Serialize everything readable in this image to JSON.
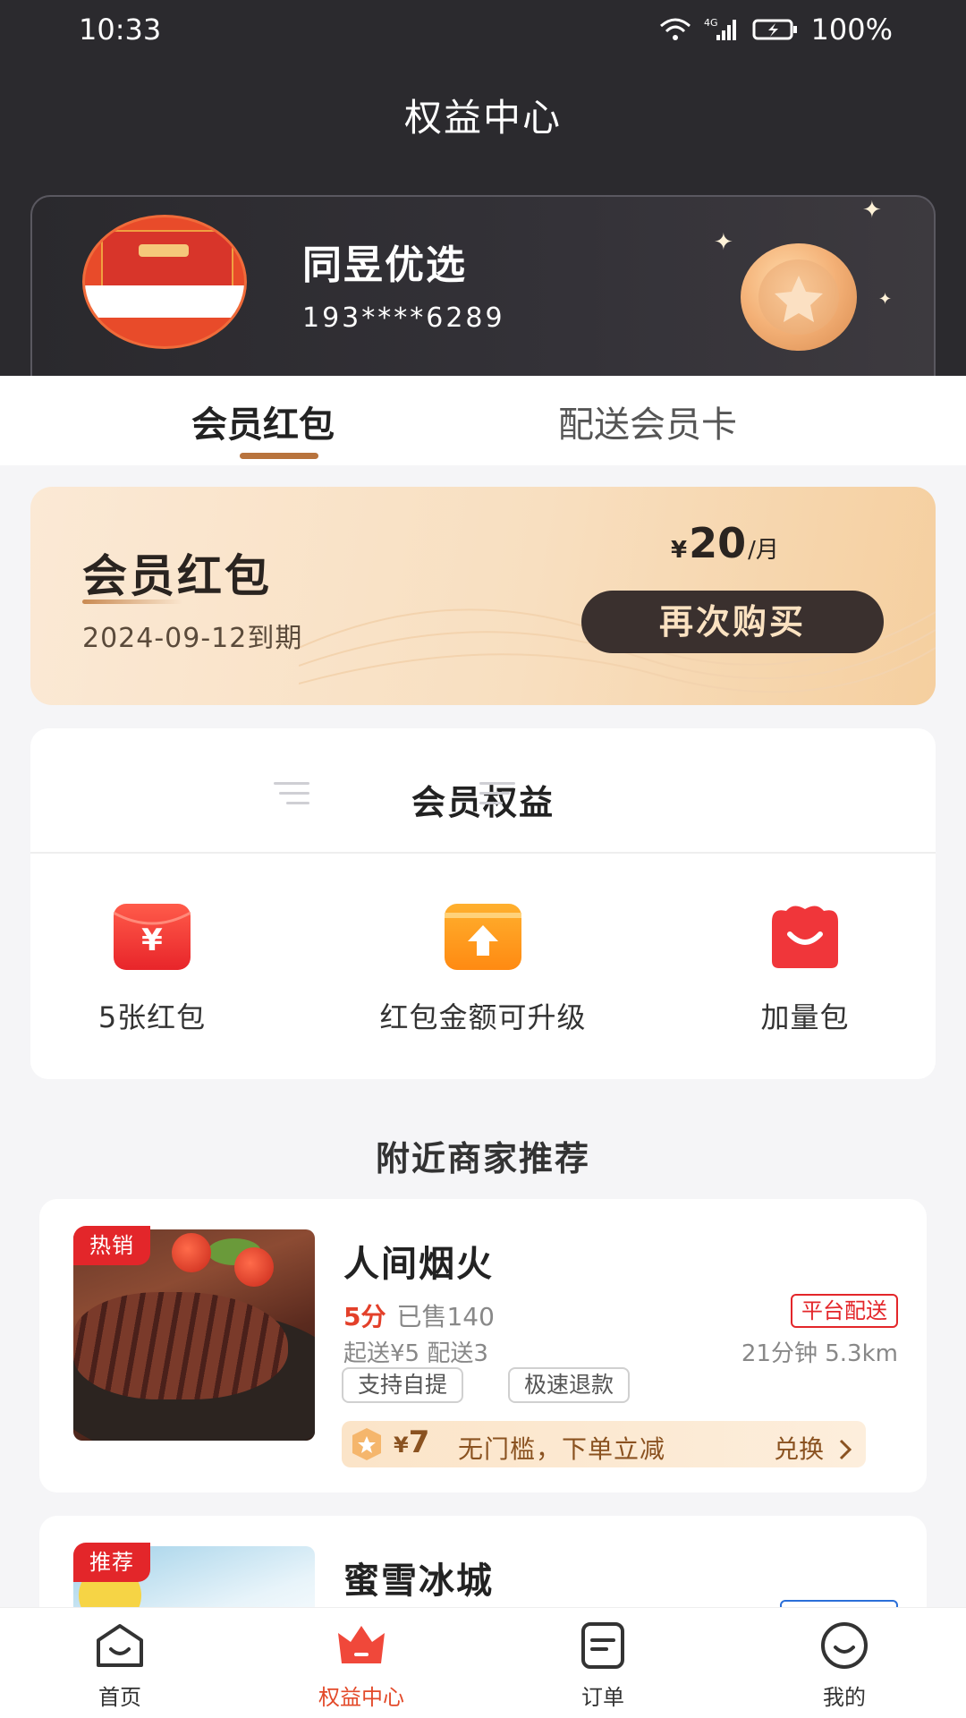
{
  "status_bar": {
    "time": "10:33",
    "battery": "100%"
  },
  "header": {
    "title": "权益中心"
  },
  "user": {
    "shop_name": "同昱优选",
    "phone": "193****6289"
  },
  "tabs": [
    {
      "label": "会员红包",
      "active": true
    },
    {
      "label": "配送会员卡",
      "active": false
    }
  ],
  "member_card": {
    "title": "会员红包",
    "expire": "2024-09-12到期",
    "price_symbol": "¥",
    "price": "20",
    "price_unit": "/月",
    "button": "再次购买"
  },
  "benefits": {
    "title": "会员权益",
    "items": [
      {
        "label": "5张红包",
        "icon": "red-envelope-icon"
      },
      {
        "label": "红包金额可升级",
        "icon": "upgrade-icon"
      },
      {
        "label": "加量包",
        "icon": "gift-bag-icon"
      }
    ]
  },
  "nearby": {
    "title": "附近商家推荐",
    "shops": [
      {
        "badge": "热销",
        "name": "人间烟火",
        "score": "5分",
        "sold": "已售140",
        "delivery_type": "平台配送",
        "fee": "起送¥5 配送3",
        "distance": "21分钟 5.3km",
        "features": [
          "支持自提",
          "极速退款"
        ],
        "coupon": {
          "symbol": "¥",
          "amount": "7",
          "desc": "无门槛，下单立减",
          "action": "兑换"
        }
      },
      {
        "badge": "推荐",
        "name": "蜜雪冰城"
      }
    ]
  },
  "bottom_nav": [
    {
      "label": "首页",
      "active": false
    },
    {
      "label": "权益中心",
      "active": true
    },
    {
      "label": "订单",
      "active": false
    },
    {
      "label": "我的",
      "active": false
    }
  ],
  "colors": {
    "accent": "#e34a2a",
    "header_bg": "#2b2a2e",
    "gold": "#b8733d"
  }
}
